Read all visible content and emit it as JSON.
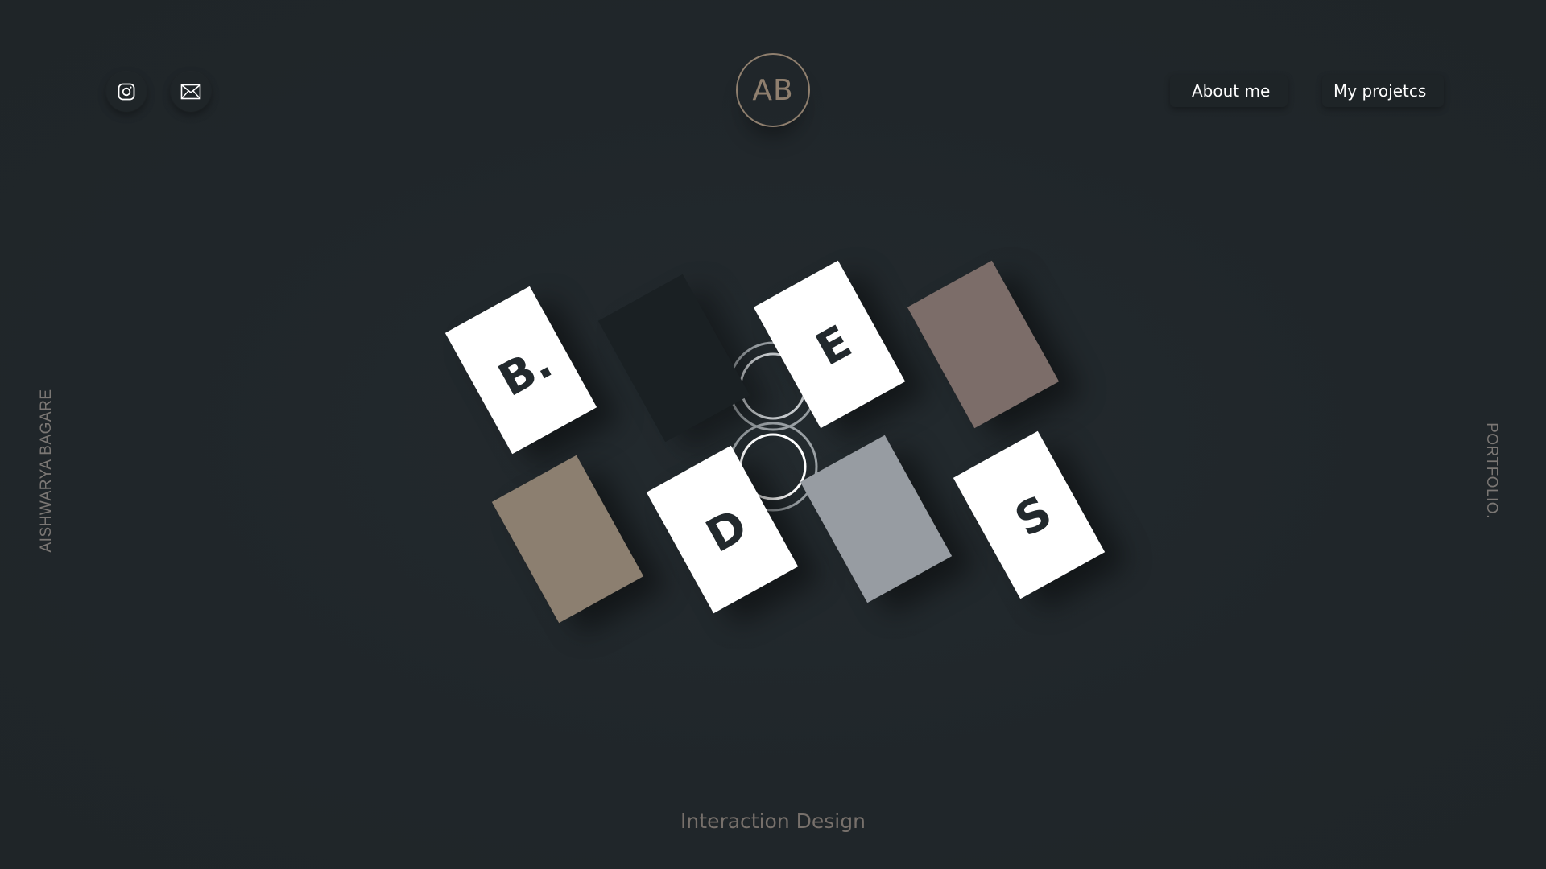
{
  "social": {
    "instagram_icon": "instagram-icon",
    "mail_icon": "mail-icon"
  },
  "logo": {
    "text": "AB",
    "color": "#8f7f6e"
  },
  "nav": {
    "about_label": "About me",
    "projects_label": "My projetcs"
  },
  "side": {
    "left_text": "AISHWARYA BAGARE",
    "right_text": "PORTFOLIO."
  },
  "cards": [
    {
      "glyph": "B.",
      "color": "#ffffff"
    },
    {
      "glyph": "",
      "color": "#1a2023"
    },
    {
      "glyph": "E",
      "color": "#ffffff"
    },
    {
      "glyph": "",
      "color": "#7c6d69"
    },
    {
      "glyph": "",
      "color": "#8c7f70"
    },
    {
      "glyph": "D",
      "color": "#ffffff"
    },
    {
      "glyph": "",
      "color": "#979ca2"
    },
    {
      "glyph": "S",
      "color": "#ffffff"
    }
  ],
  "tagline": "Interaction Design",
  "colors": {
    "background": "#21272b",
    "accent": "#8f7f6e",
    "text_muted": "#7b7774"
  }
}
